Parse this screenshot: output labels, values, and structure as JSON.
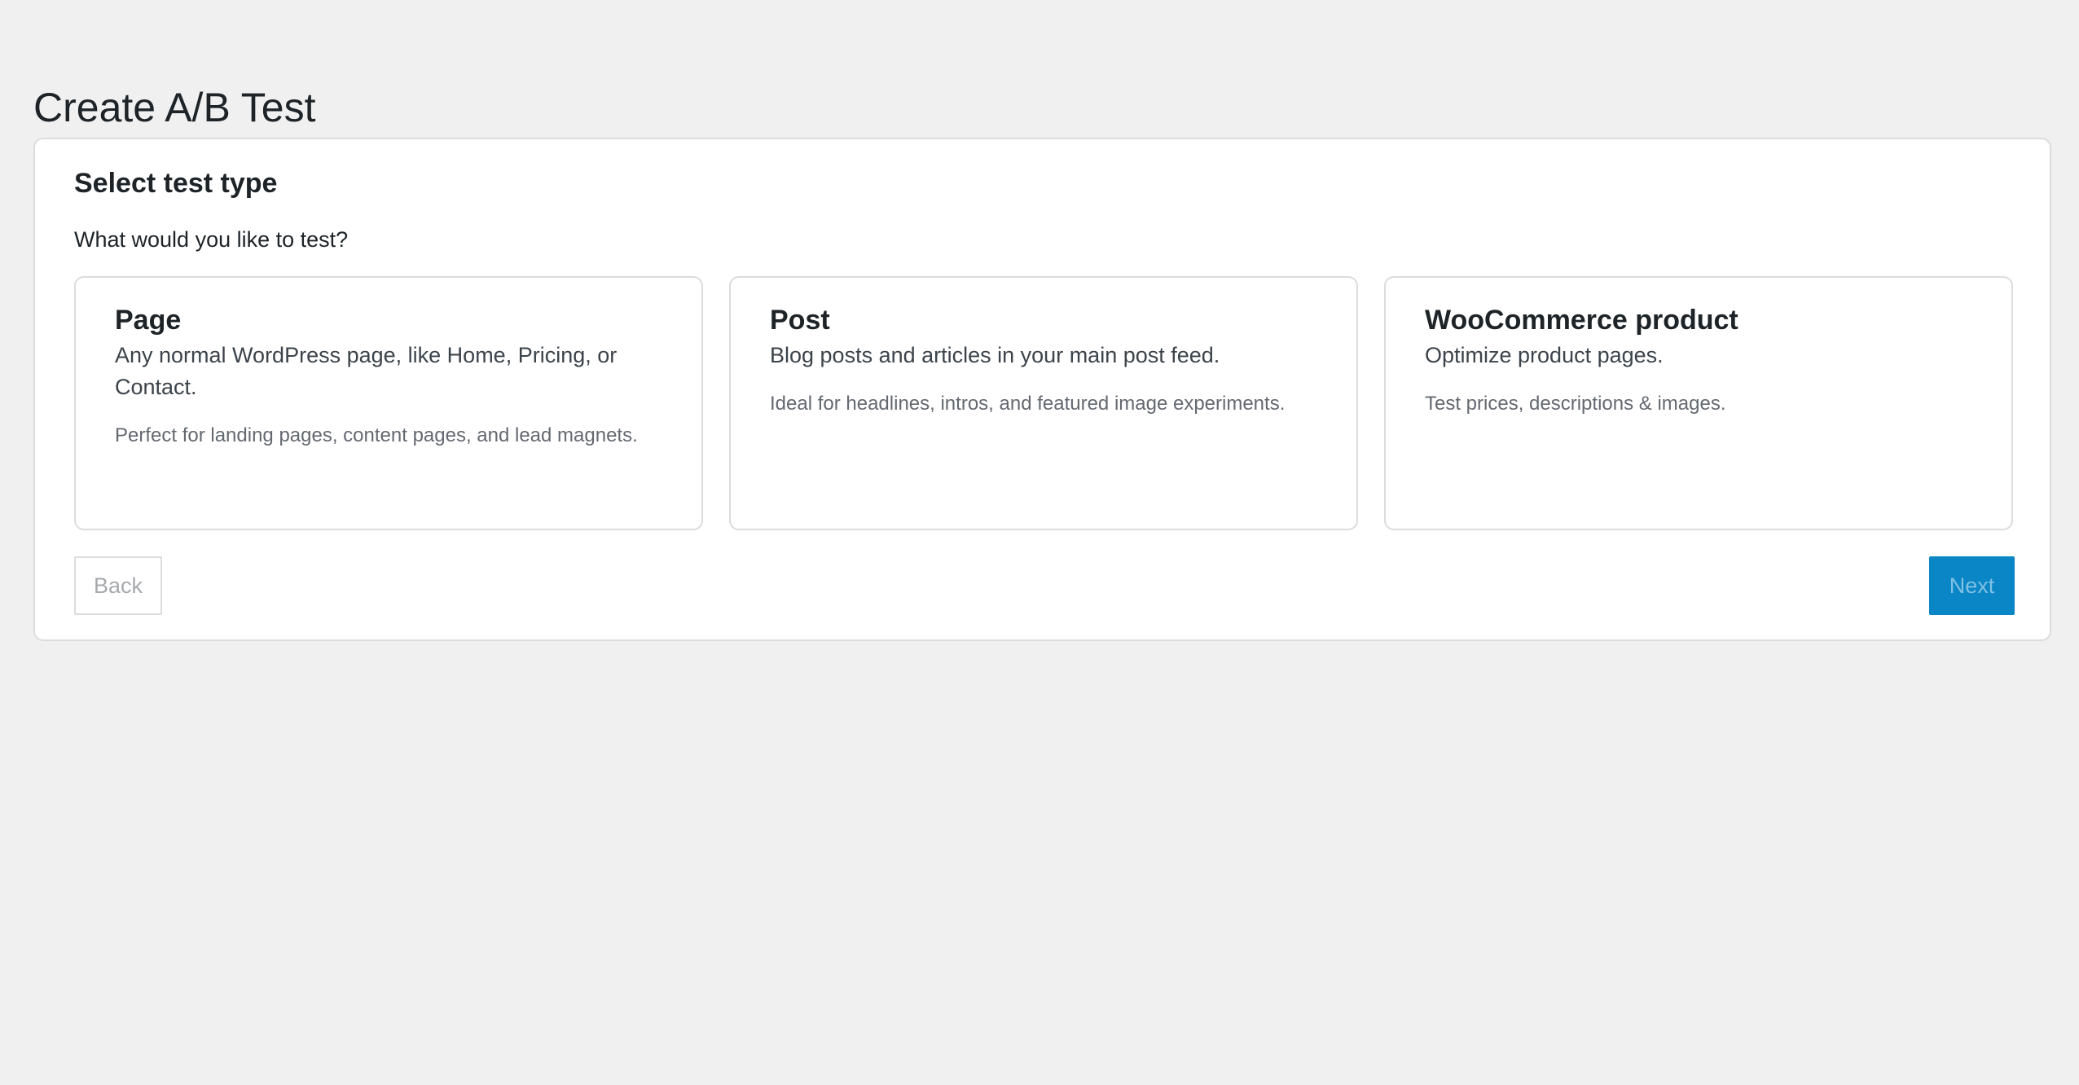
{
  "header": {
    "title": "Create A/B Test"
  },
  "panel": {
    "heading": "Select test type",
    "question": "What would you like to test?",
    "cards": [
      {
        "title": "Page",
        "description": "Any normal WordPress page, like Home, Pricing, or Contact.",
        "note": "Perfect for landing pages, content pages, and lead magnets."
      },
      {
        "title": "Post",
        "description": "Blog posts and articles in your main post feed.",
        "note": "Ideal for headlines, intros, and featured image experiments."
      },
      {
        "title": "WooCommerce product",
        "description": "Optimize product pages.",
        "note": "Test prices, descriptions & images."
      }
    ]
  },
  "actions": {
    "back_label": "Back",
    "next_label": "Next",
    "back_disabled": true,
    "next_disabled": true
  },
  "colors": {
    "background": "#f0f0f1",
    "panel": "#ffffff",
    "border": "#dcdcde",
    "primary": "#0a86c6",
    "text": "#1d2327",
    "muted_text": "#646970"
  }
}
